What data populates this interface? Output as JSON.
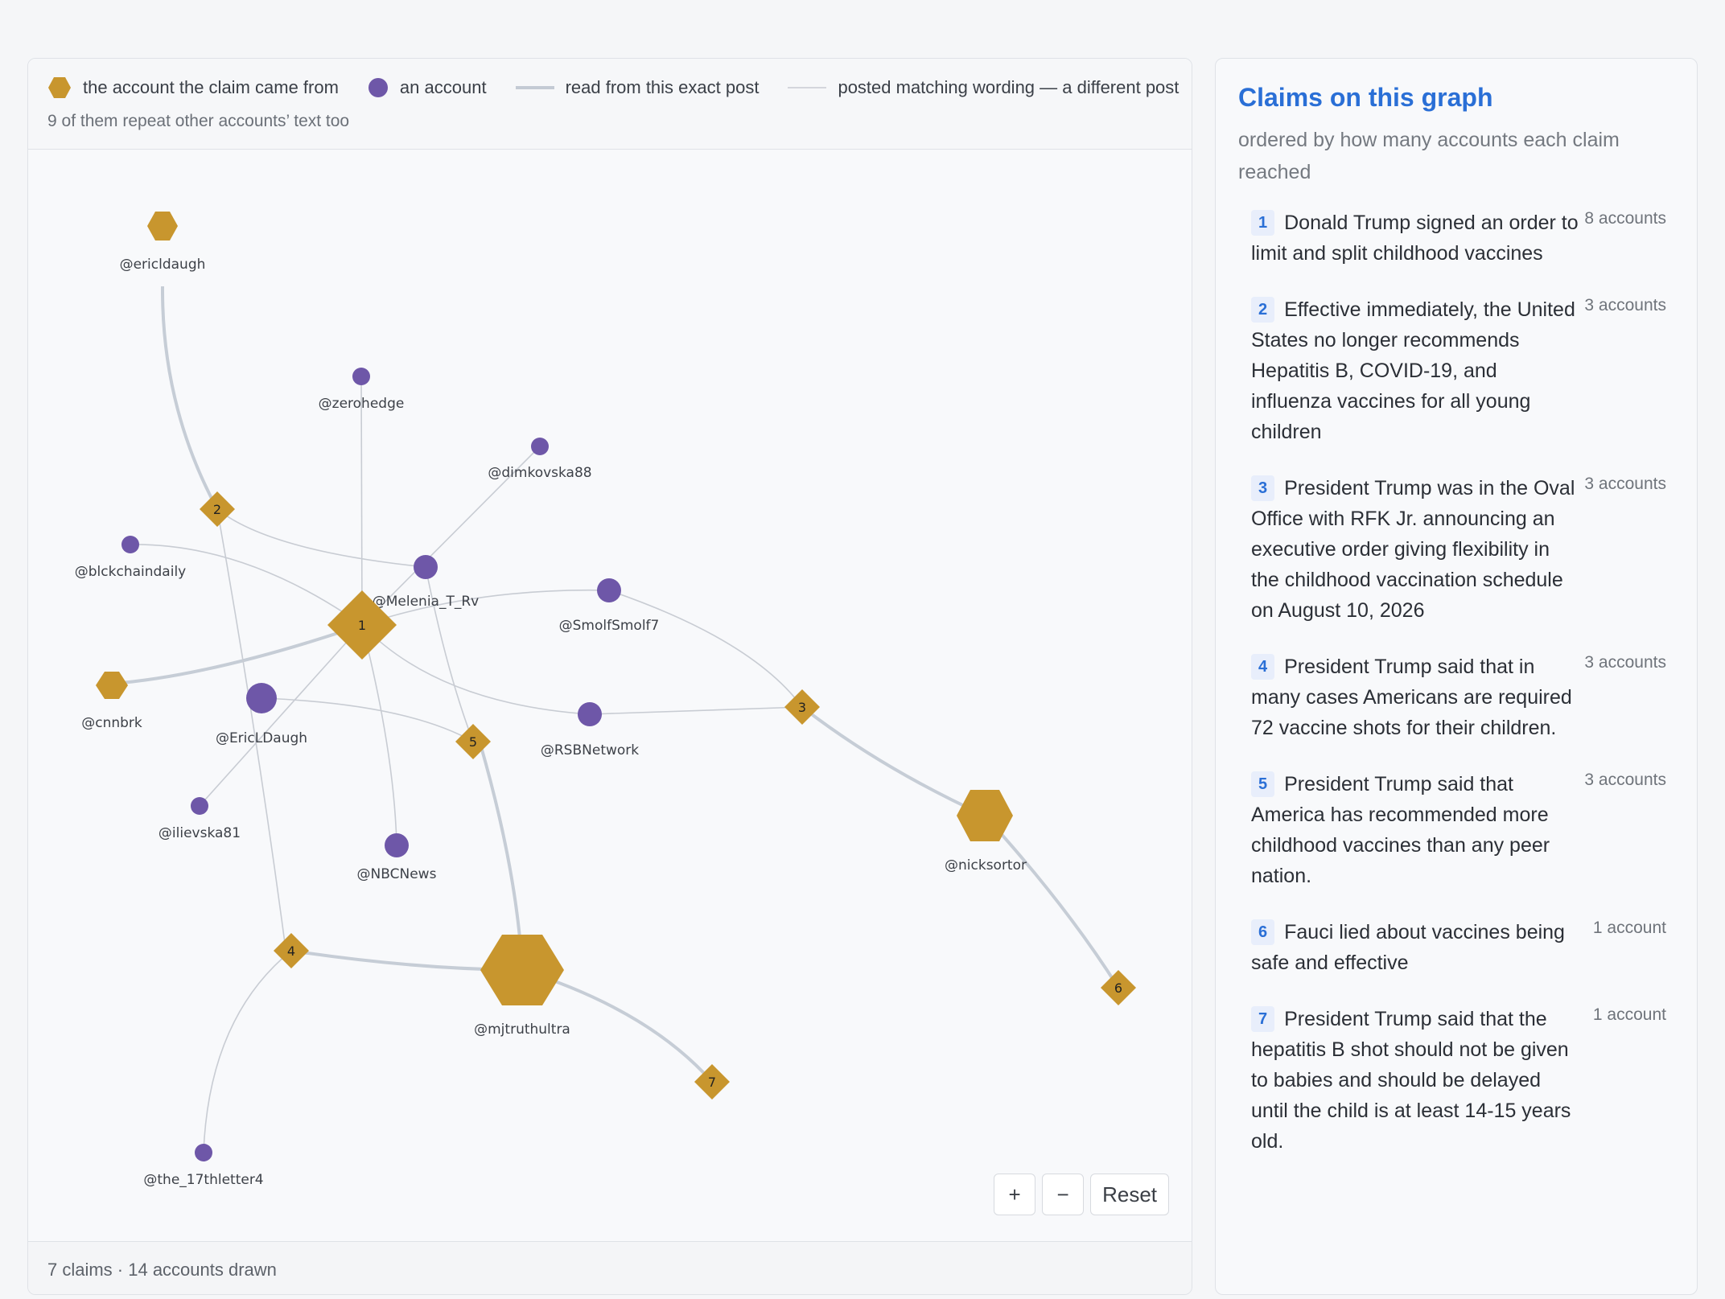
{
  "legend": {
    "origin_label": "the account the claim came from",
    "account_label": "an account",
    "exact_label": "read from this exact post",
    "matching_label": "posted matching wording — a different post",
    "note": "9 of them repeat other accounts’ text too"
  },
  "colors": {
    "claim": "#c8962e",
    "account": "#6e57a8",
    "edge": "#c8ccd3",
    "accent": "#2a6fd6"
  },
  "graph": {
    "claim_markers": [
      {
        "id": "c1",
        "label": "1"
      },
      {
        "id": "c2",
        "label": "2"
      },
      {
        "id": "c3",
        "label": "3"
      },
      {
        "id": "c4",
        "label": "4"
      },
      {
        "id": "c5",
        "label": "5"
      },
      {
        "id": "c6",
        "label": "6"
      },
      {
        "id": "c7",
        "label": "7"
      }
    ],
    "origin_accounts": [
      {
        "id": "ericldaugh",
        "label": "@ericldaugh"
      },
      {
        "id": "cnnbrk",
        "label": "@cnnbrk"
      },
      {
        "id": "nicksortor",
        "label": "@nicksortor"
      },
      {
        "id": "mjtruthultra",
        "label": "@mjtruthultra"
      }
    ],
    "accounts": [
      {
        "id": "zerohedge",
        "label": "@zerohedge"
      },
      {
        "id": "dimkovska88",
        "label": "@dimkovska88"
      },
      {
        "id": "melenia",
        "label": "@Melenia_T_Rv"
      },
      {
        "id": "blckchaindaily",
        "label": "@blckchaindaily"
      },
      {
        "id": "smolfsmolf7",
        "label": "@SmolfSmolf7"
      },
      {
        "id": "ericldaugh2",
        "label": "@EricLDaugh"
      },
      {
        "id": "rsbnetwork",
        "label": "@RSBNetwork"
      },
      {
        "id": "ilievska81",
        "label": "@ilievska81"
      },
      {
        "id": "nbcnews",
        "label": "@NBCNews"
      },
      {
        "id": "the17thletter4",
        "label": "@the_17thletter4"
      }
    ]
  },
  "zoom": {
    "zoom_in": "+",
    "zoom_out": "−",
    "reset": "Reset"
  },
  "footer": "7 claims · 14 accounts drawn",
  "claims_panel": {
    "title": "Claims on this graph",
    "subtitle": "ordered by how many accounts each claim reached",
    "items": [
      {
        "num": "1",
        "text": "Donald Trump signed an order to limit and split childhood vaccines",
        "count": "8 accounts"
      },
      {
        "num": "2",
        "text": "Effective immediately, the United States no longer recommends Hepatitis B, COVID-19, and influenza vaccines for all young children",
        "count": "3 accounts"
      },
      {
        "num": "3",
        "text": "President Trump was in the Oval Office with RFK Jr. announcing an executive order giving flexibility in the childhood vaccination schedule on August 10, 2026",
        "count": "3 accounts"
      },
      {
        "num": "4",
        "text": "President Trump said that in many cases Americans are required 72 vaccine shots for their children.",
        "count": "3 accounts"
      },
      {
        "num": "5",
        "text": "President Trump said that America has recommended more childhood vaccines than any peer nation.",
        "count": "3 accounts"
      },
      {
        "num": "6",
        "text": "Fauci lied about vaccines being safe and effective",
        "count": "1 account"
      },
      {
        "num": "7",
        "text": "President Trump said that the hepatitis B shot should not be given to babies and should be delayed until the child is at least 14-15 years old.",
        "count": "1 account"
      }
    ]
  }
}
